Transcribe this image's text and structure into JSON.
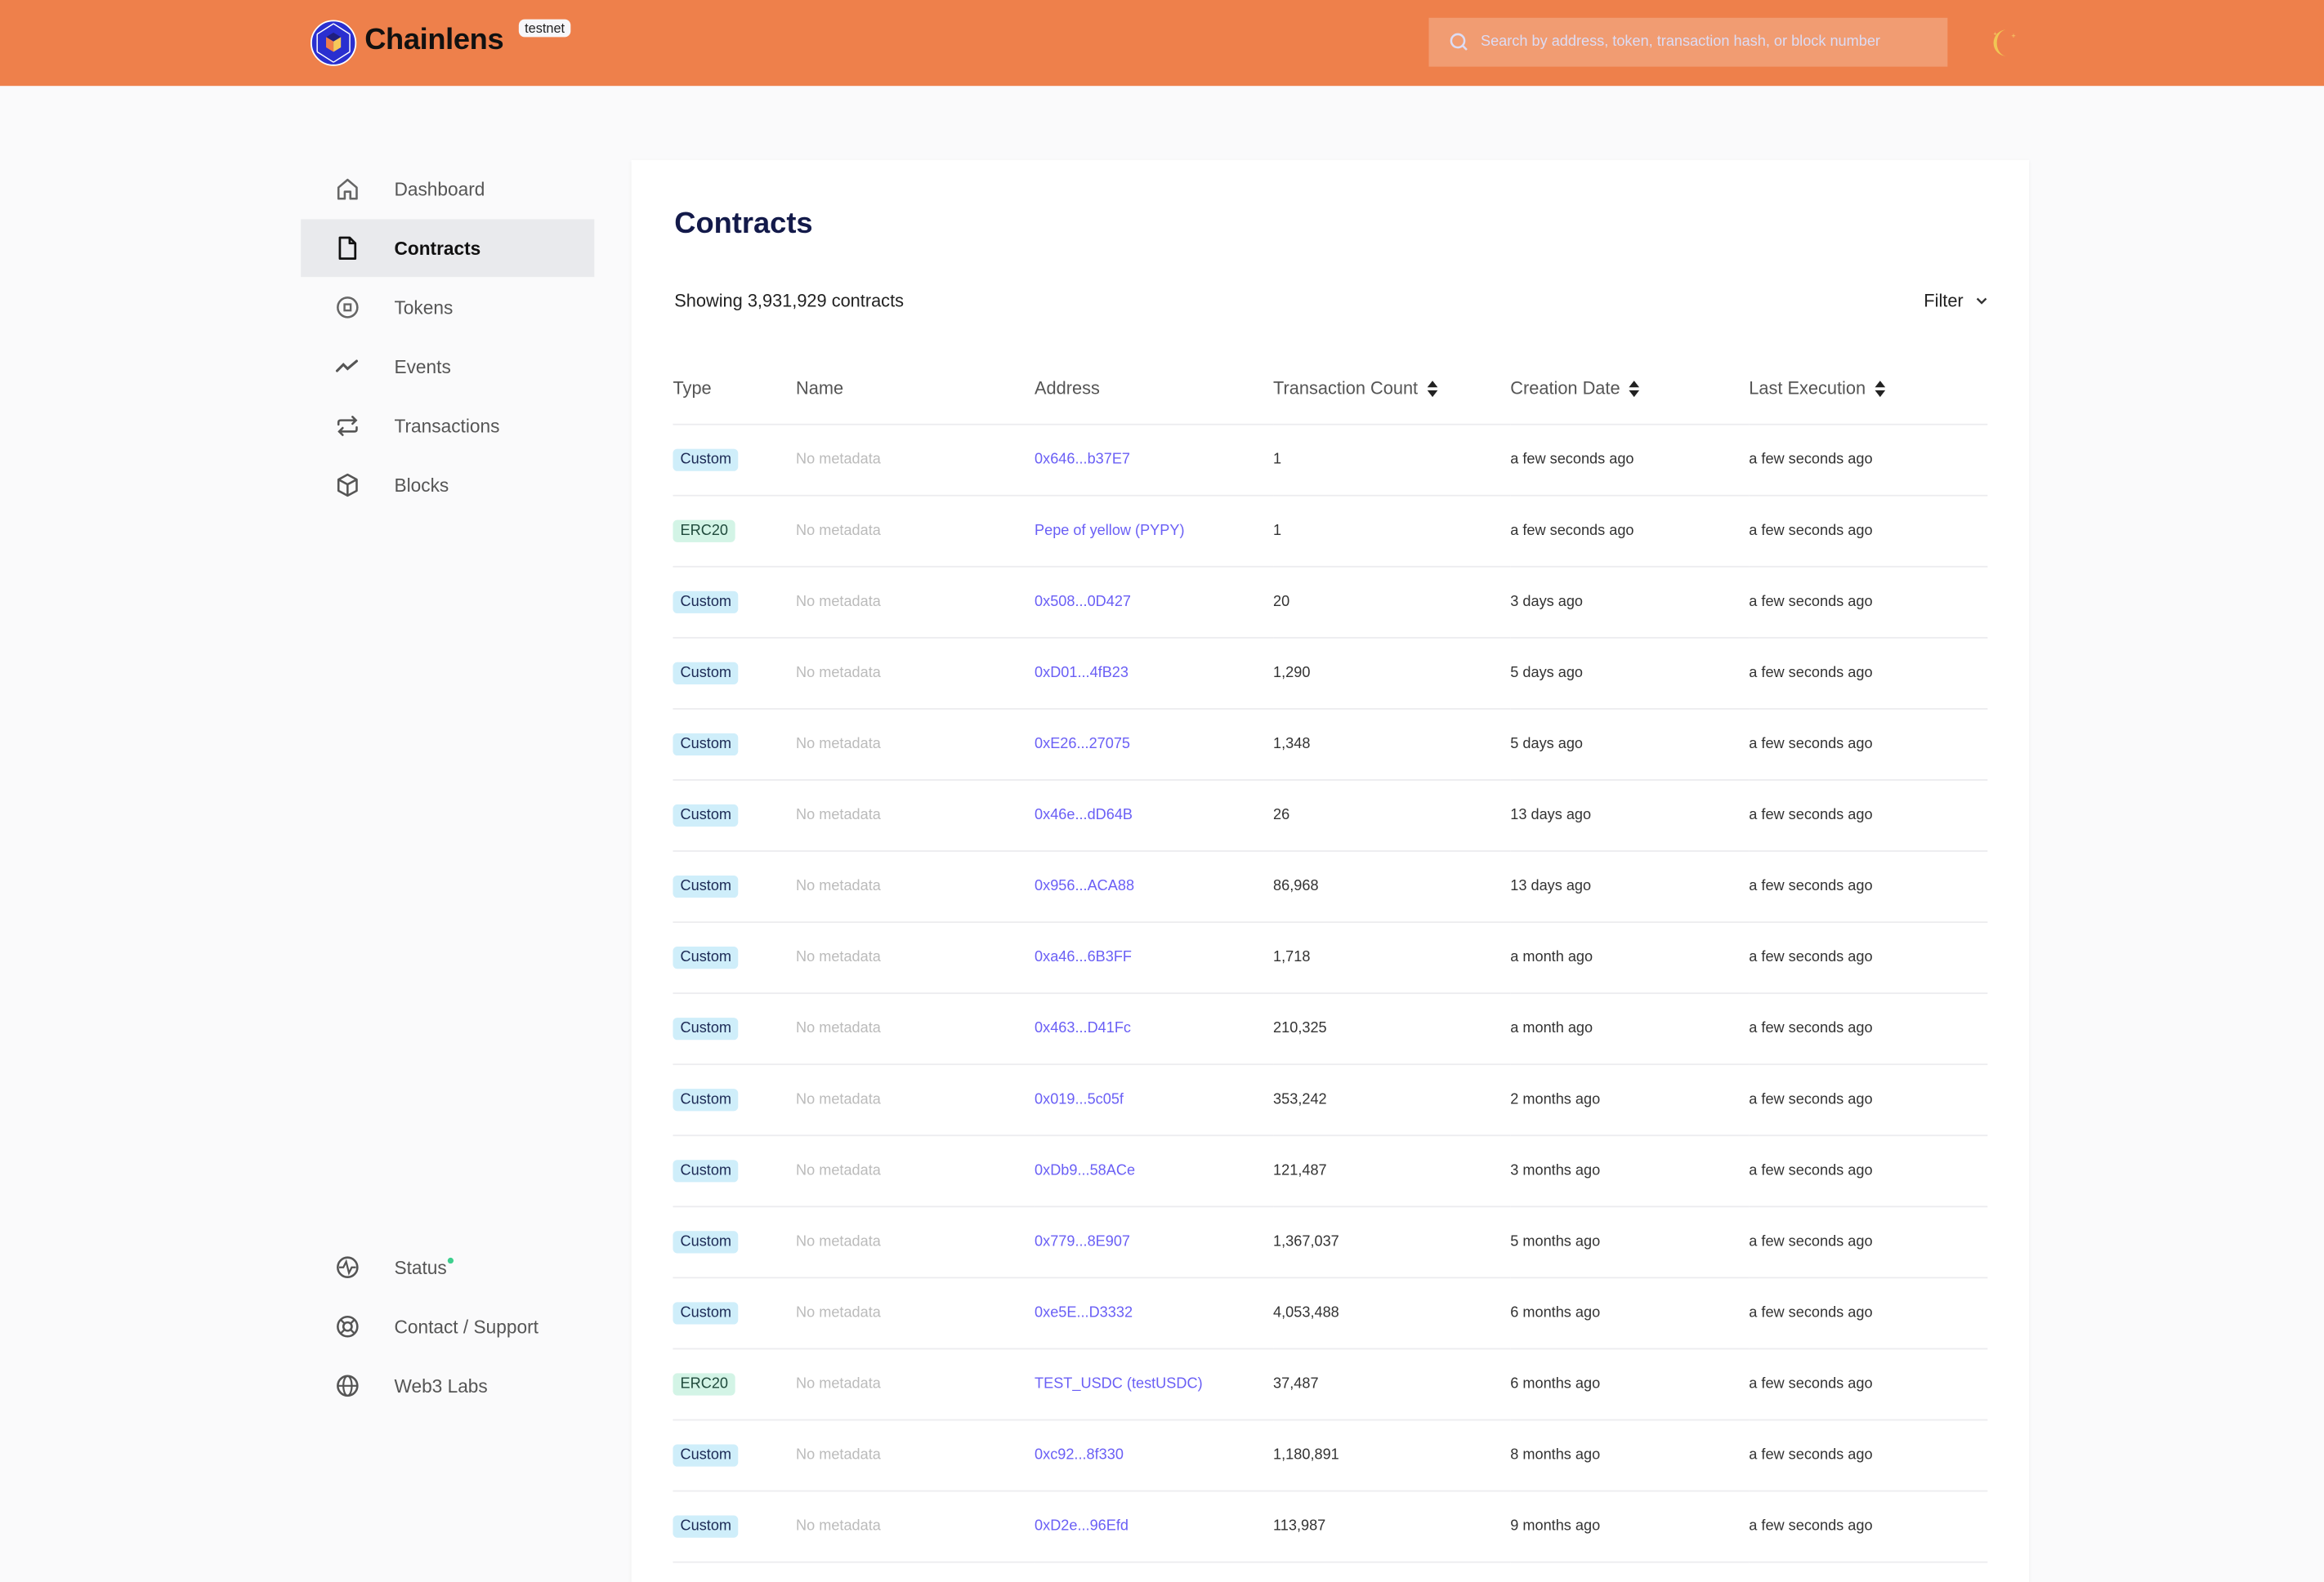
{
  "header": {
    "brand": "Chainlens",
    "network_badge": "testnet",
    "search_placeholder": "Search by address, token, transaction hash, or block number",
    "accent_color": "#ee804b"
  },
  "sidebar": {
    "items": [
      {
        "label": "Dashboard",
        "icon": "home-icon"
      },
      {
        "label": "Contracts",
        "icon": "file-icon",
        "active": true
      },
      {
        "label": "Tokens",
        "icon": "token-icon"
      },
      {
        "label": "Events",
        "icon": "activity-icon"
      },
      {
        "label": "Transactions",
        "icon": "arrows-icon"
      },
      {
        "label": "Blocks",
        "icon": "cube-icon"
      }
    ],
    "bottom_items": [
      {
        "label": "Status",
        "icon": "pulse-icon"
      },
      {
        "label": "Contact / Support",
        "icon": "lifebuoy-icon"
      },
      {
        "label": "Web3 Labs",
        "icon": "globe-icon"
      }
    ]
  },
  "main": {
    "title": "Contracts",
    "showing": "Showing 3,931,929 contracts",
    "filter_label": "Filter",
    "columns": [
      "Type",
      "Name",
      "Address",
      "Transaction Count",
      "Creation Date",
      "Last Execution"
    ],
    "rows": [
      {
        "type": "Custom",
        "name": "No metadata",
        "address": "0x646...b37E7",
        "tx_count": "1",
        "created": "a few seconds ago",
        "last_exec": "a few seconds ago"
      },
      {
        "type": "ERC20",
        "name": "No metadata",
        "address": "Pepe of yellow (PYPY)",
        "tx_count": "1",
        "created": "a few seconds ago",
        "last_exec": "a few seconds ago"
      },
      {
        "type": "Custom",
        "name": "No metadata",
        "address": "0x508...0D427",
        "tx_count": "20",
        "created": "3 days ago",
        "last_exec": "a few seconds ago"
      },
      {
        "type": "Custom",
        "name": "No metadata",
        "address": "0xD01...4fB23",
        "tx_count": "1,290",
        "created": "5 days ago",
        "last_exec": "a few seconds ago"
      },
      {
        "type": "Custom",
        "name": "No metadata",
        "address": "0xE26...27075",
        "tx_count": "1,348",
        "created": "5 days ago",
        "last_exec": "a few seconds ago"
      },
      {
        "type": "Custom",
        "name": "No metadata",
        "address": "0x46e...dD64B",
        "tx_count": "26",
        "created": "13 days ago",
        "last_exec": "a few seconds ago"
      },
      {
        "type": "Custom",
        "name": "No metadata",
        "address": "0x956...ACA88",
        "tx_count": "86,968",
        "created": "13 days ago",
        "last_exec": "a few seconds ago"
      },
      {
        "type": "Custom",
        "name": "No metadata",
        "address": "0xa46...6B3FF",
        "tx_count": "1,718",
        "created": "a month ago",
        "last_exec": "a few seconds ago"
      },
      {
        "type": "Custom",
        "name": "No metadata",
        "address": "0x463...D41Fc",
        "tx_count": "210,325",
        "created": "a month ago",
        "last_exec": "a few seconds ago"
      },
      {
        "type": "Custom",
        "name": "No metadata",
        "address": "0x019...5c05f",
        "tx_count": "353,242",
        "created": "2 months ago",
        "last_exec": "a few seconds ago"
      },
      {
        "type": "Custom",
        "name": "No metadata",
        "address": "0xDb9...58ACe",
        "tx_count": "121,487",
        "created": "3 months ago",
        "last_exec": "a few seconds ago"
      },
      {
        "type": "Custom",
        "name": "No metadata",
        "address": "0x779...8E907",
        "tx_count": "1,367,037",
        "created": "5 months ago",
        "last_exec": "a few seconds ago"
      },
      {
        "type": "Custom",
        "name": "No metadata",
        "address": "0xe5E...D3332",
        "tx_count": "4,053,488",
        "created": "6 months ago",
        "last_exec": "a few seconds ago"
      },
      {
        "type": "ERC20",
        "name": "No metadata",
        "address": "TEST_USDC (testUSDC)",
        "tx_count": "37,487",
        "created": "6 months ago",
        "last_exec": "a few seconds ago"
      },
      {
        "type": "Custom",
        "name": "No metadata",
        "address": "0xc92...8f330",
        "tx_count": "1,180,891",
        "created": "8 months ago",
        "last_exec": "a few seconds ago"
      },
      {
        "type": "Custom",
        "name": "No metadata",
        "address": "0xD2e...96Efd",
        "tx_count": "113,987",
        "created": "9 months ago",
        "last_exec": "a few seconds ago"
      }
    ]
  }
}
